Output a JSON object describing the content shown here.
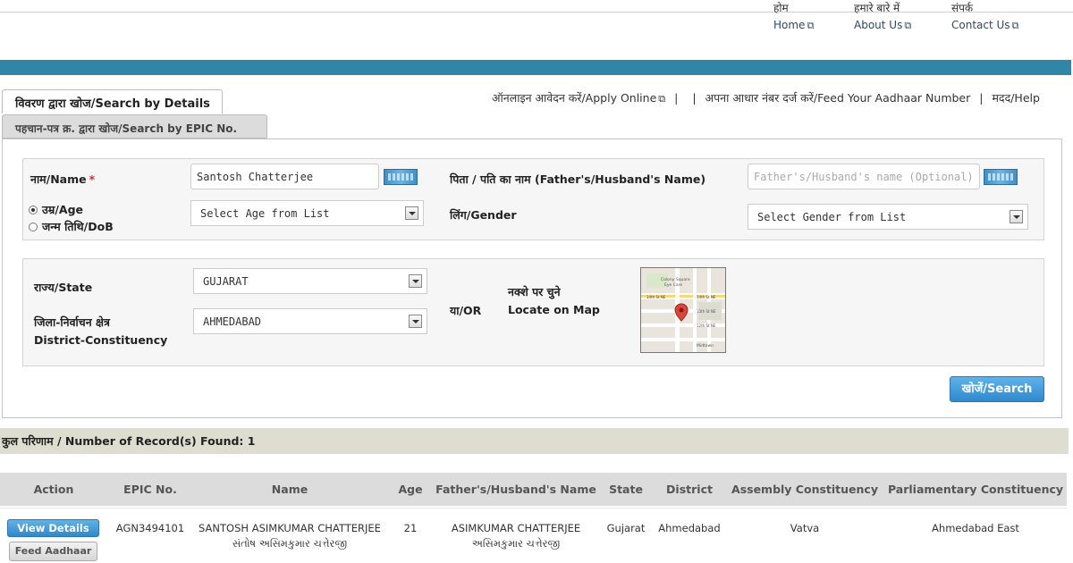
{
  "topnav": {
    "home": {
      "hi": "होम",
      "en": "Home"
    },
    "about": {
      "hi": "हमारे बारे में",
      "en": "About Us"
    },
    "contact": {
      "hi": "संपर्क",
      "en": "Contact Us"
    }
  },
  "tabs": {
    "details": "विवरण द्वारा खोज/Search by Details",
    "epic": "पहचान-पत्र क्र. द्वारा खोज/Search by EPIC No."
  },
  "toplinks": {
    "apply": "ऑनलाइन आवेदन करें/Apply Online",
    "aadhaar": "अपना आधार नंबर दर्ज करें/Feed Your Aadhaar Number",
    "help": "मदद/Help",
    "sep1": "|",
    "sep2": "|",
    "sep3": "|"
  },
  "form": {
    "name_label": "नाम/Name",
    "required_mark": "*",
    "name_value": "Santosh Chatterjee",
    "father_label": "पिता / पति का नाम (Father's/Husband's Name)",
    "father_placeholder": "Father's/Husband's name (Optional)",
    "age_radio": "उम्र/Age",
    "dob_radio": "जन्म तिथि/DoB",
    "age_select": "Select Age from List",
    "gender_label": "लिंग/Gender",
    "gender_select": "Select Gender from List",
    "state_label": "राज्य/State",
    "state_value": "GUJARAT",
    "district_label_hi": "जिला-निर्वाचन क्षेत्र",
    "district_label_en": "District-Constituency",
    "district_value": "AHMEDABAD",
    "or_label": "या/OR",
    "map_label_hi": "नक्शे पर चुने",
    "map_label_en": "Locate on Map",
    "search_button": "खोजें/Search"
  },
  "map_streets": [
    "14th St NE",
    "14th St NE",
    "13th St NE",
    "12th St NE",
    "Midtown",
    "Colony Square",
    "Eye Care"
  ],
  "records": {
    "label_hi": "कुल परिणाम",
    "label_sep": " / ",
    "label_en": "Number of Record(s) Found: 1"
  },
  "table": {
    "headers": [
      "Action",
      "EPIC No.",
      "Name",
      "Age",
      "Father's/Husband's Name",
      "State",
      "District",
      "Assembly Constituency",
      "Parliamentary Constituency"
    ],
    "row": {
      "view_button": "View Details",
      "feed_button": "Feed Aadhaar No.",
      "epic": "AGN3494101",
      "name_en": "SANTOSH ASIMKUMAR CHATTERJEE",
      "name_gu": "સંતોષ અસિમકુમાર ચત્તેરજી",
      "age": "21",
      "father_en": "ASIMKUMAR CHATTERJEE",
      "father_gu": "અસિમકુમાર ચત્તેરજી",
      "state": "Gujarat",
      "district": "Ahmedabad",
      "assembly": "Vatva",
      "parliamentary": "Ahmedabad East"
    }
  },
  "colors": {
    "bluebar": "#2f86a6",
    "button": "#2f89cc",
    "records_bg": "#ddddd0"
  }
}
